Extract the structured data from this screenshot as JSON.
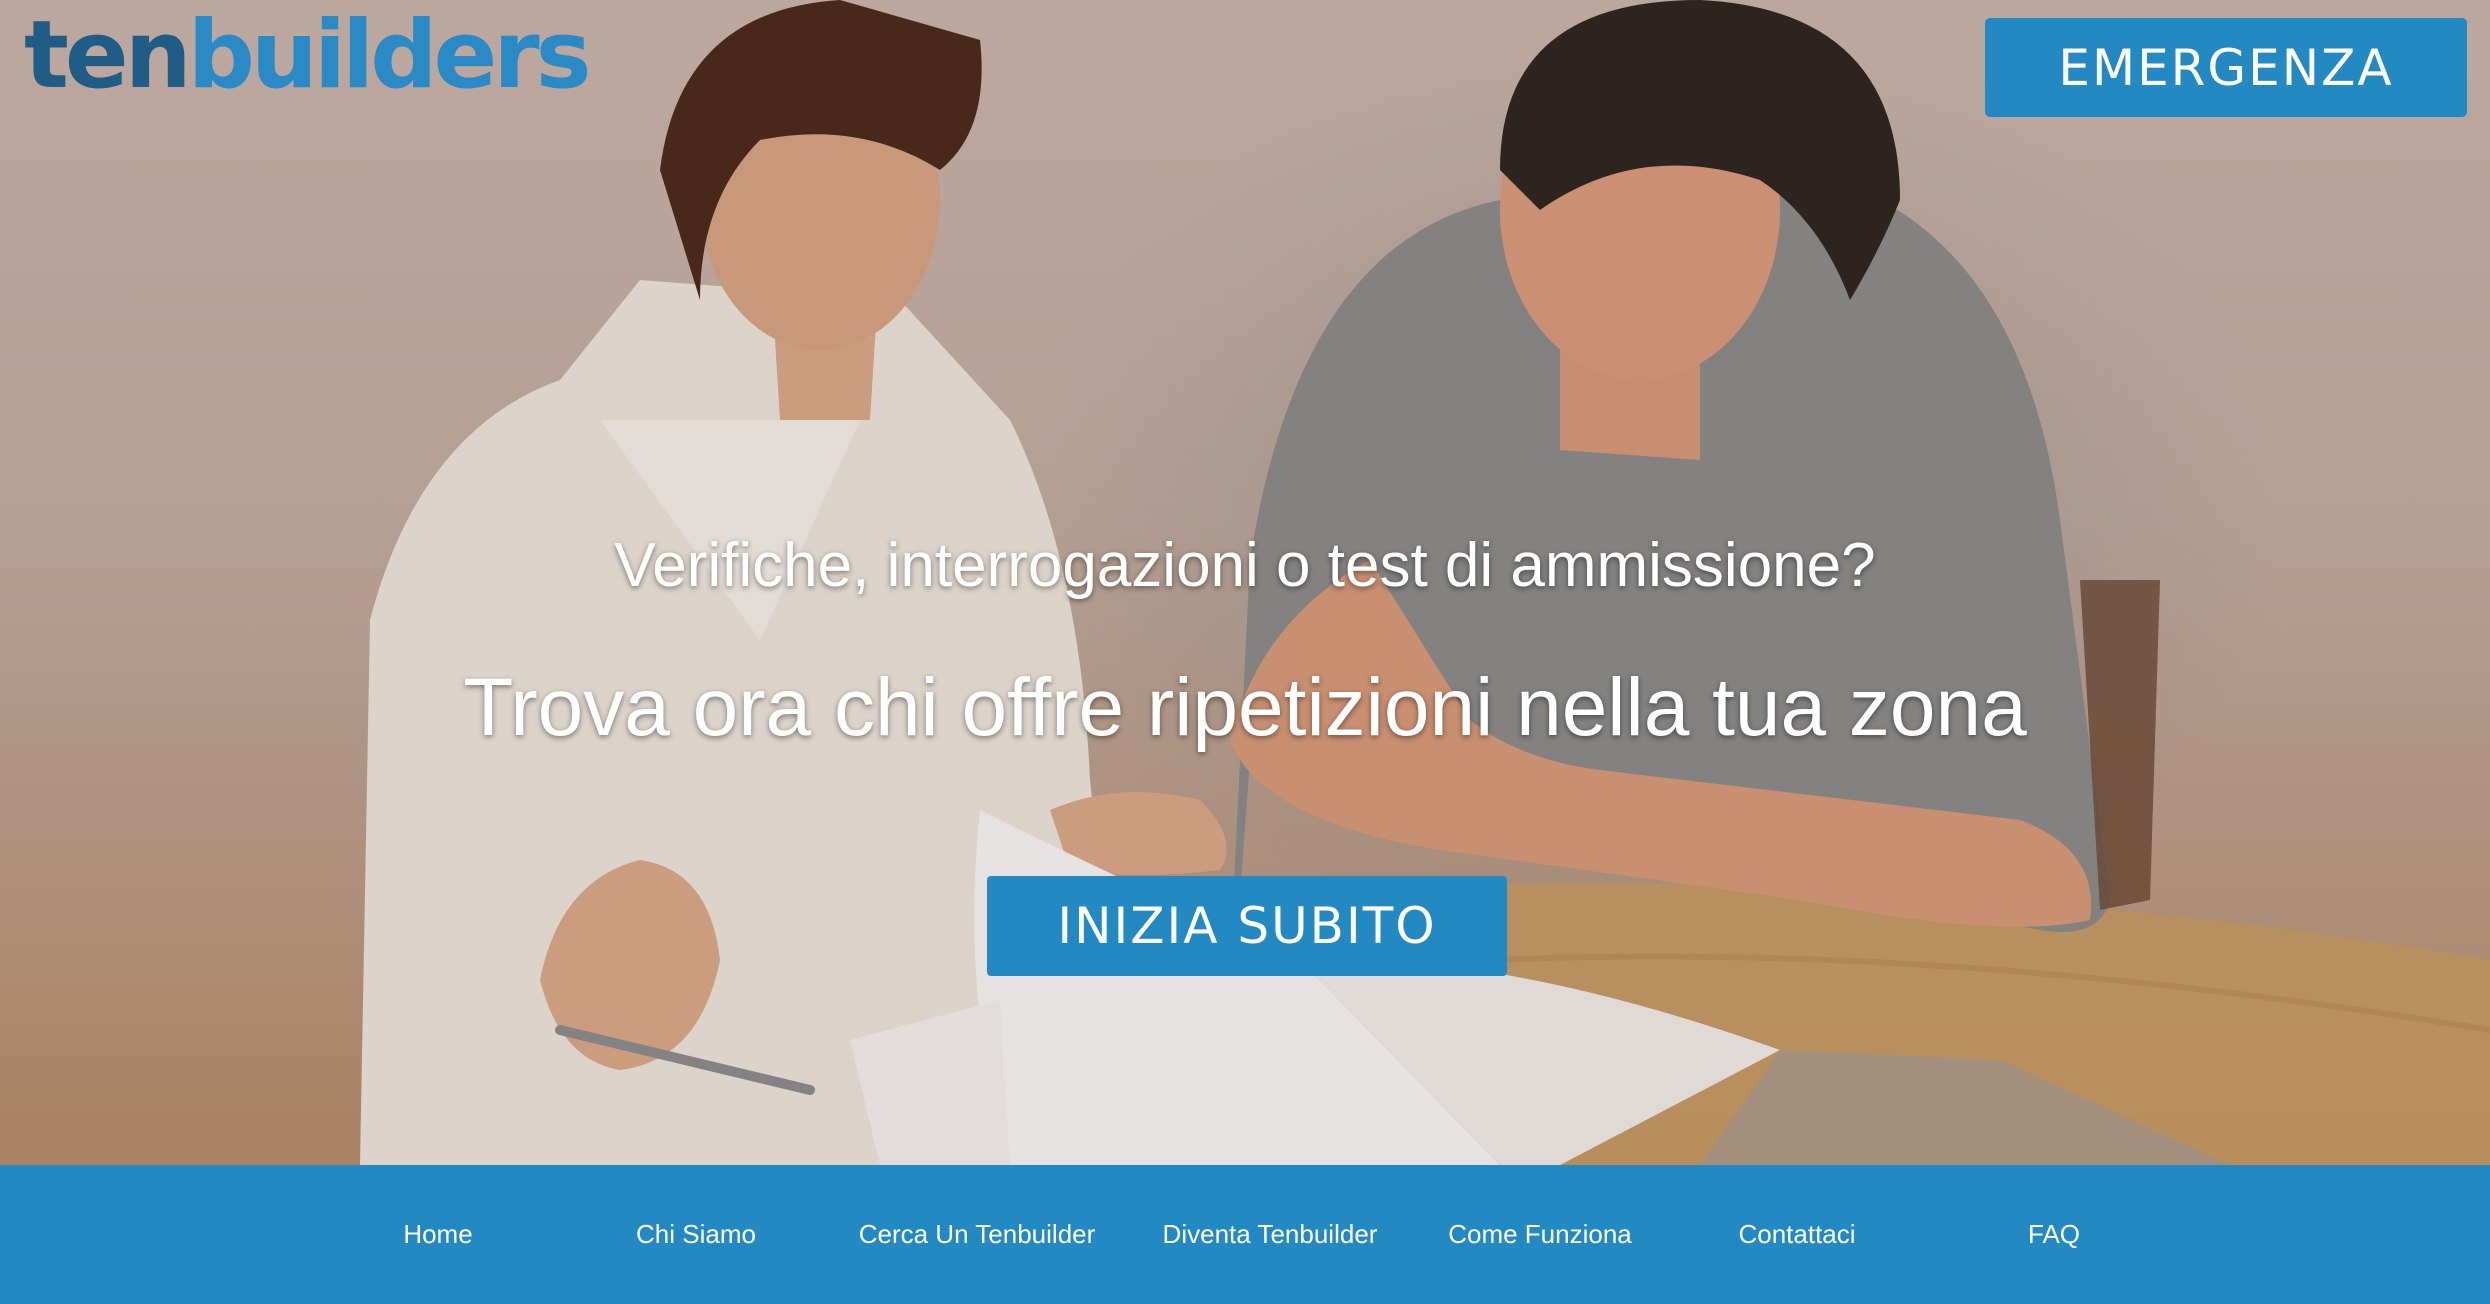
{
  "logo": {
    "part1": "ten",
    "part2": "builders"
  },
  "emergency_label": "EMERGENZA",
  "hero": {
    "subtitle": "Verifiche, interrogazioni o test di ammissione?",
    "title": "Trova ora chi offre ripetizioni nella tua zona",
    "cta_label": "INIZIA SUBITO"
  },
  "nav": {
    "items": [
      {
        "label": "Home"
      },
      {
        "label": "Chi Siamo"
      },
      {
        "label": "Cerca Un Tenbuilder"
      },
      {
        "label": "Diventa Tenbuilder"
      },
      {
        "label": "Come Funziona"
      },
      {
        "label": "Contattaci"
      },
      {
        "label": "FAQ"
      }
    ]
  },
  "colors": {
    "brand_blue": "#2389c3",
    "logo_dark": "#1f5d86",
    "logo_light": "#2a8ac6"
  }
}
